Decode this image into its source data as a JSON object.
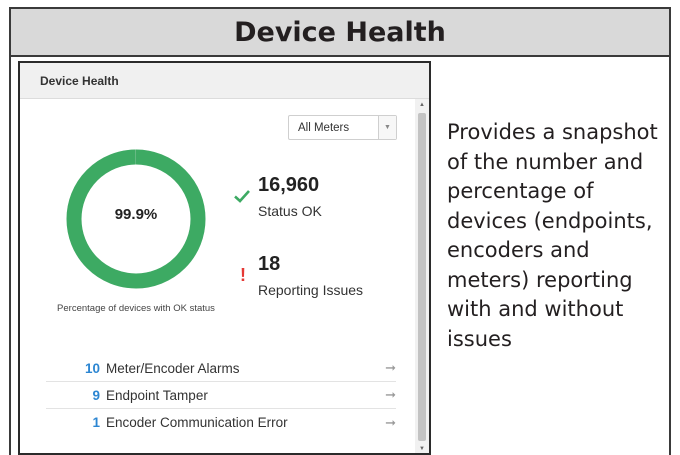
{
  "header": {
    "title": "Device Health"
  },
  "widget": {
    "title": "Device Health",
    "filter": {
      "selected": "All Meters"
    },
    "donut": {
      "percent_text": "99.9%",
      "ok_fraction": 0.999,
      "caption": "Percentage of devices with OK status",
      "color": "#3daa63",
      "track_color": "#e8e8e8"
    },
    "status_ok": {
      "count": "16,960",
      "label": "Status OK"
    },
    "issues": {
      "count": "18",
      "label": "Reporting Issues"
    },
    "list": [
      {
        "count": "10",
        "label": "Meter/Encoder Alarms"
      },
      {
        "count": "9",
        "label": "Endpoint Tamper"
      },
      {
        "count": "1",
        "label": "Encoder Communication Error"
      }
    ]
  },
  "description": "Provides a snapshot of the number and percentage of devices (endpoints, encoders and meters) reporting with and without issues",
  "colors": {
    "accent": "#2c86d2",
    "ok": "#3daa63",
    "error": "#e53935"
  }
}
